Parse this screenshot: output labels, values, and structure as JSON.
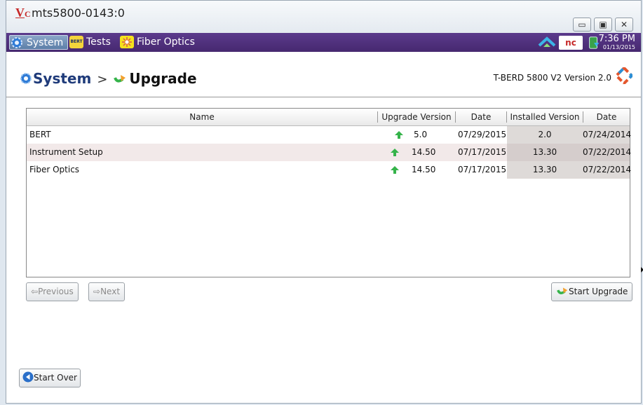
{
  "window": {
    "icon_text": "V",
    "icon_sub": "C",
    "title": "mts5800-0143:0",
    "min_symbol": "▭",
    "max_symbol": "▣",
    "close_symbol": "✕"
  },
  "taskbar": {
    "items": [
      {
        "label": "System",
        "icon": "gear-icon"
      },
      {
        "label": "Tests",
        "icon": "bert-icon",
        "icon_text": "BERT"
      },
      {
        "label": "Fiber Optics",
        "icon": "fiber-icon"
      }
    ],
    "nc_label": "nc",
    "time": "7:36 PM",
    "date": "01/13/2015"
  },
  "header": {
    "crumb_root": "System",
    "crumb_sep": ">",
    "crumb_current": "Upgrade",
    "version": "T-BERD 5800 V2 Version 2.0"
  },
  "table": {
    "columns": [
      "Name",
      "Upgrade Version",
      "Date",
      "Installed Version",
      "Date"
    ],
    "rows": [
      {
        "name": "BERT",
        "upgrade_version": "5.0",
        "upgrade_date": "07/29/2015",
        "installed_version": "2.0",
        "installed_date": "07/24/2014"
      },
      {
        "name": "Instrument Setup",
        "upgrade_version": "14.50",
        "upgrade_date": "07/17/2015",
        "installed_version": "13.30",
        "installed_date": "07/22/2014"
      },
      {
        "name": "Fiber Optics",
        "upgrade_version": "14.50",
        "upgrade_date": "07/17/2015",
        "installed_version": "13.30",
        "installed_date": "07/22/2014"
      }
    ]
  },
  "buttons": {
    "previous": "Previous",
    "next": "Next",
    "start_upgrade": "Start Upgrade",
    "start_over": "Start Over"
  },
  "colors": {
    "taskbar": "#4f3180",
    "accent_green": "#35b34a",
    "crumb": "#1f3b7a"
  }
}
